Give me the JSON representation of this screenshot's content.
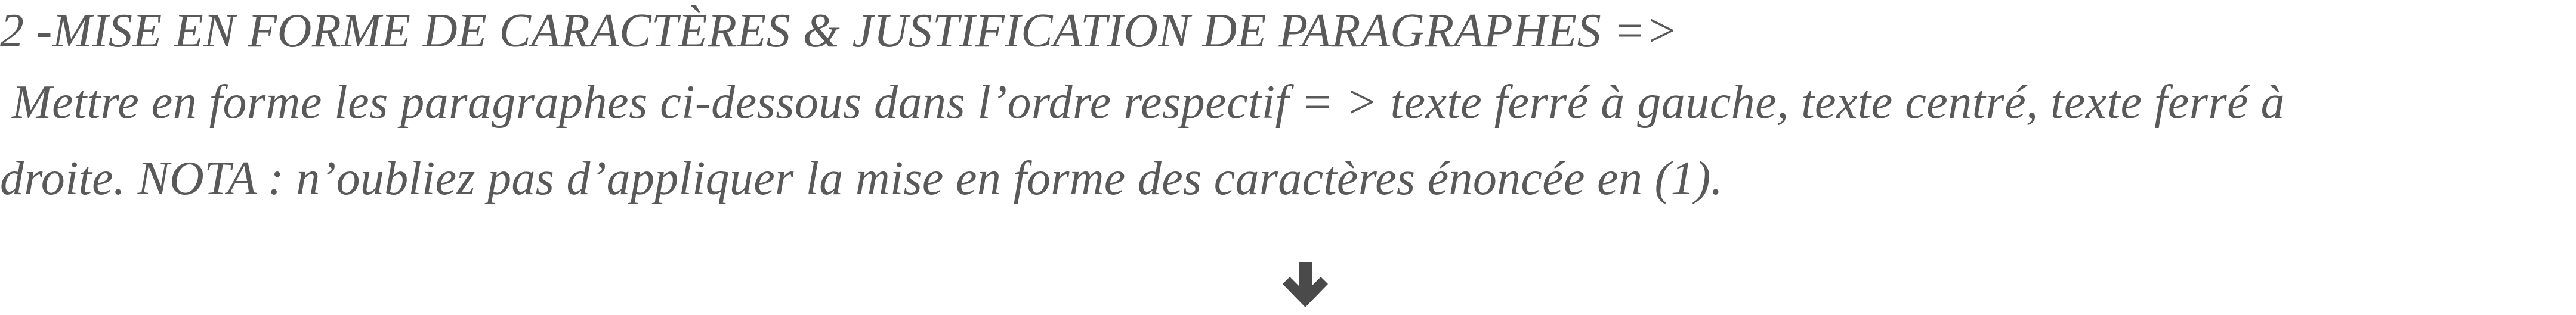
{
  "document": {
    "heading": "2 -MISE EN FORME DE CARACTÈRES & JUSTIFICATION DE PARAGRAPHES =>",
    "instruction_line1": "Mettre en forme les paragraphes ci-dessous dans l’ordre respectif = > texte ferré à gauche, texte centré, texte ferré à",
    "instruction_line2": "droite. NOTA : n’oubliez pas d’appliquer la mise en forme des caractères énoncée en (1).",
    "arrow_icon": "arrow-down-icon",
    "text_color": "#595959",
    "arrow_color": "#4a4a4a"
  }
}
